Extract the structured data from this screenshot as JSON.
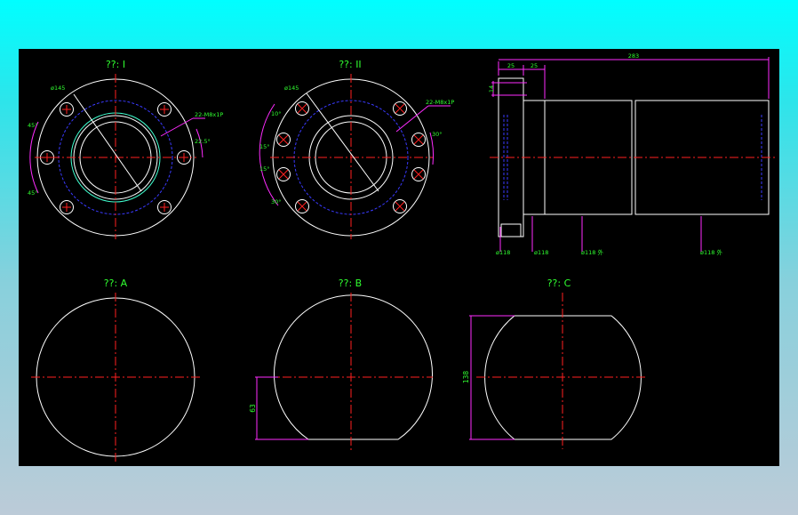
{
  "colors": {
    "background": "#000000",
    "outline": "#ffffff",
    "centerline": "#ff2020",
    "dimension": "#ff2cff",
    "text": "#30ff30",
    "hidden": "#3a3aff",
    "accent": "#40ffd0"
  },
  "views": {
    "view1": {
      "title": "??: I",
      "pcd_label": "ø145",
      "hole_label": "22-M8x1P",
      "angle_top": "45°",
      "angle_bottom": "45°",
      "angle_right": "22.5°"
    },
    "view2": {
      "title": "??: II",
      "pcd_label": "ø145",
      "hole_label": "22-M8x1P",
      "angle_a": "10°",
      "angle_b": "15°",
      "angle_c": "15°",
      "angle_d": "30°",
      "angle_right": "30°"
    },
    "side": {
      "dim_total": "283",
      "dim_a": "25",
      "dim_b": "25",
      "dim_c": "14",
      "label_1": "ø118",
      "label_2": "ø118",
      "label_3": "ø118 外",
      "label_4": "ø118 外"
    },
    "viewA": {
      "title": "??: A"
    },
    "viewB": {
      "title": "??: B",
      "dim": "63"
    },
    "viewC": {
      "title": "??: C",
      "dim": "138"
    }
  }
}
